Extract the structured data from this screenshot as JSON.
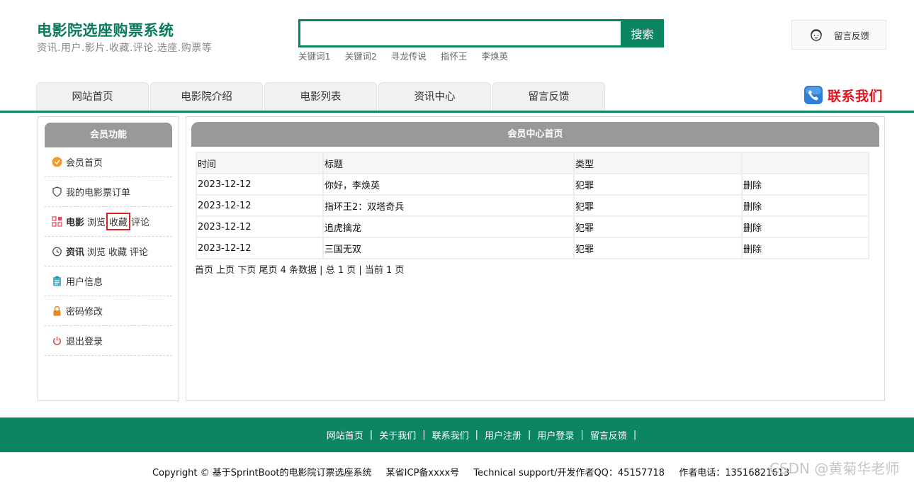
{
  "header": {
    "title": "电影院选座购票系统",
    "subtitle": "资讯.用户.影片.收藏.评论.选座.购票等",
    "search": {
      "value": "",
      "placeholder": "",
      "button": "搜索"
    },
    "keywords": [
      "关键词1",
      "关键词2",
      "寻龙传说",
      "指怀王",
      "李焕英"
    ],
    "feedback": "留言反馈"
  },
  "nav": {
    "items": [
      "网站首页",
      "电影院介绍",
      "电影列表",
      "资讯中心",
      "留言反馈"
    ],
    "contact": "联系我们"
  },
  "sidebar": {
    "title": "会员功能",
    "items": [
      {
        "icon": "orange-circle-icon",
        "label": "会员首页"
      },
      {
        "icon": "shield-icon",
        "label": "我的电影票订单"
      },
      {
        "icon": "grid-icon",
        "label": "电影",
        "links": [
          "浏览",
          "收藏",
          "评论"
        ]
      },
      {
        "icon": "clock-icon",
        "label": "资讯",
        "links": [
          "浏览",
          "收藏",
          "评论"
        ]
      },
      {
        "icon": "clipboard-icon",
        "label": "用户信息"
      },
      {
        "icon": "lock-icon",
        "label": "密码修改"
      },
      {
        "icon": "power-icon",
        "label": "退出登录"
      }
    ]
  },
  "main": {
    "title": "会员中心首页",
    "columns": [
      "时间",
      "标题",
      "类型",
      ""
    ],
    "rows": [
      {
        "time": "2023-12-12",
        "title": "你好，李焕英",
        "type": "犯罪",
        "action": "删除"
      },
      {
        "time": "2023-12-12",
        "title": "指环王2：双塔奇兵",
        "type": "犯罪",
        "action": "删除"
      },
      {
        "time": "2023-12-12",
        "title": "追虎擒龙",
        "type": "犯罪",
        "action": "删除"
      },
      {
        "time": "2023-12-12",
        "title": "三国无双",
        "type": "犯罪",
        "action": "删除"
      }
    ],
    "pager": {
      "first": "首页",
      "prev": "上页",
      "next": "下页",
      "last": "尾页",
      "count": "4 条数据",
      "total": "总 1 页",
      "current": "当前 1 页"
    }
  },
  "footer": {
    "links": [
      "网站首页",
      "关于我们",
      "联系我们",
      "用户注册",
      "用户登录",
      "留言反馈"
    ],
    "copyright": "Copyright © 基于SprintBoot的电影院订票选座系统",
    "icp": "某省ICP备xxxx号",
    "support": "Technical support/开发作者QQ：45157718",
    "phone": "作者电话：13516821613",
    "watermark": "CSDN @黄菊华老师"
  },
  "colors": {
    "brand": "#0b8660",
    "accent": "#e0151d",
    "head": "#999999"
  }
}
